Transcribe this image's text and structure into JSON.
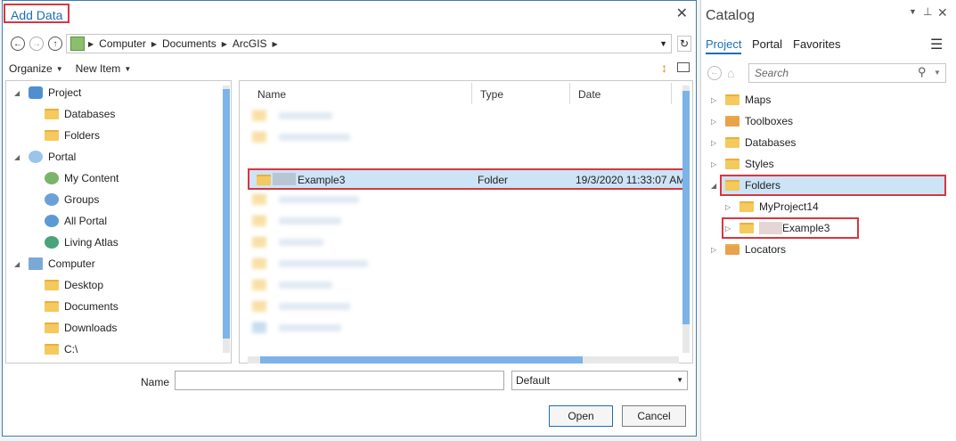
{
  "dialog": {
    "title": "Add Data",
    "close_glyph": "✕",
    "nav": {
      "back_glyph": "←",
      "forward_glyph": "→",
      "up_glyph": "↑"
    },
    "breadcrumb": [
      "Computer",
      "Documents",
      "ArcGIS"
    ],
    "toolbar": {
      "organize": "Organize",
      "new_item": "New Item"
    },
    "nav_tree": [
      {
        "label": "Project",
        "indent": 0
      },
      {
        "label": "Databases",
        "indent": 1
      },
      {
        "label": "Folders",
        "indent": 1
      },
      {
        "label": "Portal",
        "indent": 0
      },
      {
        "label": "My Content",
        "indent": 1
      },
      {
        "label": "Groups",
        "indent": 1
      },
      {
        "label": "All Portal",
        "indent": 1
      },
      {
        "label": "Living Atlas",
        "indent": 1
      },
      {
        "label": "Computer",
        "indent": 0
      },
      {
        "label": "Desktop",
        "indent": 1
      },
      {
        "label": "Documents",
        "indent": 1
      },
      {
        "label": "Downloads",
        "indent": 1
      },
      {
        "label": "C:\\",
        "indent": 1
      }
    ],
    "columns": {
      "name": "Name",
      "type": "Type",
      "date": "Date"
    },
    "selected_file": {
      "name": "Example3",
      "type": "Folder",
      "date": "19/3/2020 11:33:07 AM"
    },
    "name_label": "Name",
    "name_value": "",
    "filter_value": "Default",
    "open_label": "Open",
    "cancel_label": "Cancel"
  },
  "catalog": {
    "title": "Catalog",
    "tabs": [
      "Project",
      "Portal",
      "Favorites"
    ],
    "search_placeholder": "Search",
    "items": [
      "Maps",
      "Toolboxes",
      "Databases",
      "Styles",
      "Folders",
      "MyProject14",
      "Example3",
      "Locators"
    ]
  },
  "colors": {
    "accent": "#1a6fb5",
    "highlight_border": "#d9363e",
    "selection": "#cde3f6"
  }
}
